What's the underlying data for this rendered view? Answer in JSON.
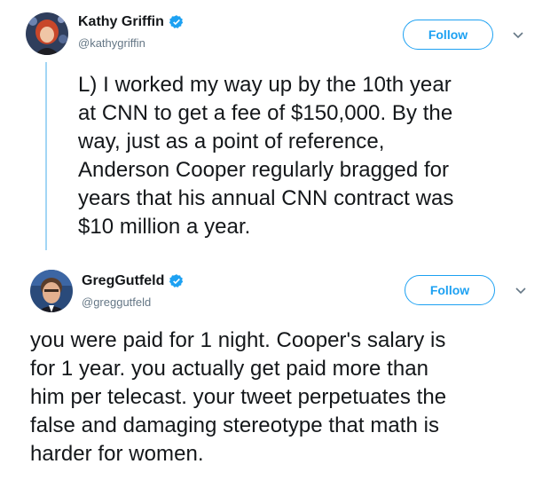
{
  "tweets": [
    {
      "display_name": "Kathy Griffin",
      "handle": "@kathygriffin",
      "verified": true,
      "follow_label": "Follow",
      "text": "L) I worked my way up by the 10th year\nat CNN to get a fee of $150,000. By the\nway, just as a point of reference,\nAnderson Cooper regularly bragged for\nyears that his annual CNN contract was\n$10 million a year."
    },
    {
      "display_name": "GregGutfeld",
      "handle": "@greggutfeld",
      "verified": true,
      "follow_label": "Follow",
      "text": "you were paid for 1 night. Cooper's salary is\nfor 1 year. you actually get paid more than\nhim per telecast. your tweet perpetuates the\nfalse and damaging stereotype that math is\nharder for women."
    }
  ],
  "colors": {
    "accent": "#1da1f2",
    "thread_line": "#a3d6f5",
    "secondary_text": "#657786",
    "primary_text": "#14171a"
  },
  "icons": {
    "verified": "verified-badge-icon",
    "menu": "chevron-down-icon"
  }
}
